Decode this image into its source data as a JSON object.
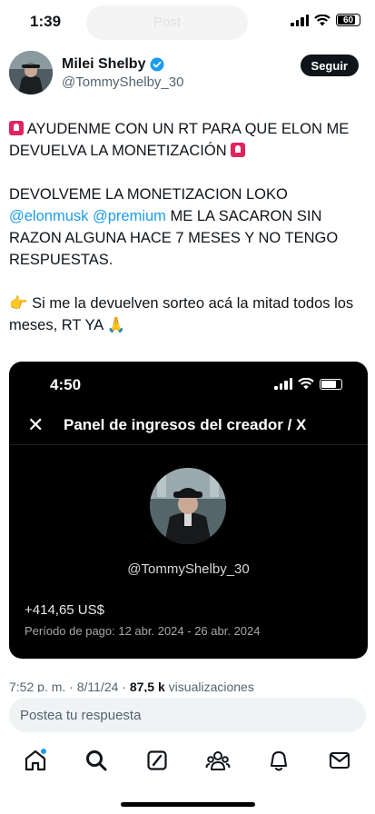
{
  "status_bar": {
    "time": "1:39",
    "battery": "60",
    "ghost_label": "Post"
  },
  "author": {
    "name": "Milei Shelby",
    "handle": "@TommyShelby_30",
    "follow_label": "Seguir"
  },
  "tweet": {
    "line1": "AYUDENME CON UN RT PARA QUE ELON ME DEVUELVA LA MONETIZACIÓN",
    "line2_pre": "DEVOLVEME LA MONETIZACION LOKO",
    "mention1": "@elonmusk",
    "mention2": "@premium",
    "line2_post": "ME LA SACARON SIN RAZON ALGUNA HACE 7 MESES Y NO TENGO RESPUESTAS.",
    "line3": "Si me la devuelven sorteo acá la mitad todos los meses, RT YA"
  },
  "embed": {
    "time": "4:50",
    "title": "Panel de ingresos del creador / X",
    "handle": "@TommyShelby_30",
    "amount": "+414,65 US$",
    "period": "Período de pago: 12 abr. 2024 - 26 abr. 2024"
  },
  "meta": {
    "time": "7:52 p. m.",
    "date": "8/11/24",
    "views_count": "87,5 k",
    "views_label": "visualizaciones"
  },
  "reply": {
    "placeholder": "Postea tu respuesta"
  },
  "tabs": [
    "home-icon",
    "search-icon",
    "grok-icon",
    "communities-icon",
    "notifications-icon",
    "messages-icon"
  ],
  "colors": {
    "accent": "#1d9bf0",
    "text": "#0f1419",
    "muted": "#536471"
  }
}
